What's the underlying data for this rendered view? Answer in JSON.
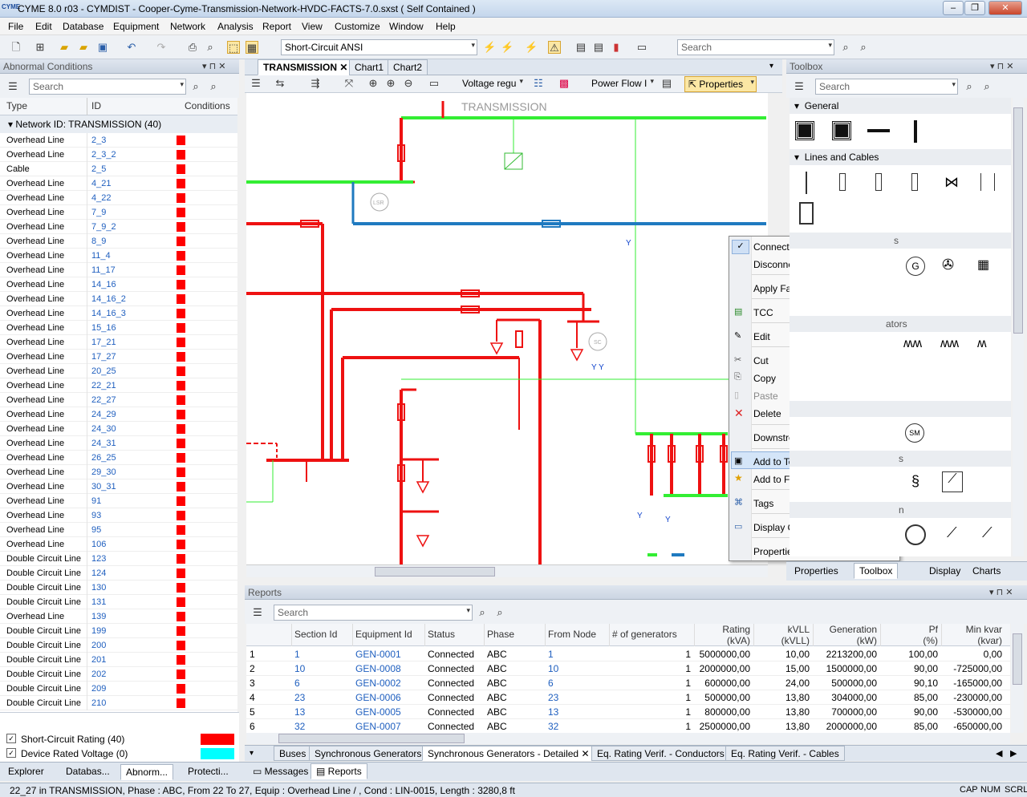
{
  "app": {
    "title": "CYME 8.0 r03 - CYMDIST - Cooper-Cyme-Transmission-Network-HVDC-FACTS-7.0.sxst ( Self Contained )",
    "logo": "CYME",
    "min": "–",
    "restore": "❐",
    "close": "✕"
  },
  "menu": [
    "File",
    "Edit",
    "Database",
    "Equipment",
    "Network",
    "Analysis",
    "Report",
    "View",
    "Customize",
    "Window",
    "Help"
  ],
  "toolbar": {
    "analysis_combo": "Short-Circuit ANSI",
    "search_placeholder": "Search",
    "dd": "▾"
  },
  "left": {
    "title": "Abnormal Conditions",
    "ctrl": "▾ ⊓ ✕",
    "search_placeholder": "Search",
    "col_type": "Type",
    "col_id": "ID",
    "col_cond": "Conditions",
    "group": "Network ID: TRANSMISSION (40)",
    "rows": [
      [
        "Overhead Line",
        "2_3"
      ],
      [
        "Overhead Line",
        "2_3_2"
      ],
      [
        "Cable",
        "2_5"
      ],
      [
        "Overhead Line",
        "4_21"
      ],
      [
        "Overhead Line",
        "4_22"
      ],
      [
        "Overhead Line",
        "7_9"
      ],
      [
        "Overhead Line",
        "7_9_2"
      ],
      [
        "Overhead Line",
        "8_9"
      ],
      [
        "Overhead Line",
        "11_4"
      ],
      [
        "Overhead Line",
        "11_17"
      ],
      [
        "Overhead Line",
        "14_16"
      ],
      [
        "Overhead Line",
        "14_16_2"
      ],
      [
        "Overhead Line",
        "14_16_3"
      ],
      [
        "Overhead Line",
        "15_16"
      ],
      [
        "Overhead Line",
        "17_21"
      ],
      [
        "Overhead Line",
        "17_27"
      ],
      [
        "Overhead Line",
        "20_25"
      ],
      [
        "Overhead Line",
        "22_21"
      ],
      [
        "Overhead Line",
        "22_27"
      ],
      [
        "Overhead Line",
        "24_29"
      ],
      [
        "Overhead Line",
        "24_30"
      ],
      [
        "Overhead Line",
        "24_31"
      ],
      [
        "Overhead Line",
        "26_25"
      ],
      [
        "Overhead Line",
        "29_30"
      ],
      [
        "Overhead Line",
        "30_31"
      ],
      [
        "Overhead Line",
        "91"
      ],
      [
        "Overhead Line",
        "93"
      ],
      [
        "Overhead Line",
        "95"
      ],
      [
        "Overhead Line",
        "106"
      ],
      [
        "Double Circuit Line",
        "123"
      ],
      [
        "Double Circuit Line",
        "124"
      ],
      [
        "Double Circuit Line",
        "130"
      ],
      [
        "Double Circuit Line",
        "131"
      ],
      [
        "Overhead Line",
        "139"
      ],
      [
        "Double Circuit Line",
        "199"
      ],
      [
        "Double Circuit Line",
        "200"
      ],
      [
        "Double Circuit Line",
        "201"
      ],
      [
        "Double Circuit Line",
        "202"
      ],
      [
        "Double Circuit Line",
        "209"
      ],
      [
        "Double Circuit Line",
        "210"
      ]
    ],
    "legend": [
      {
        "label": "Short-Circuit Rating (40)",
        "color": "#ff0000"
      },
      {
        "label": "Device Rated Voltage (0)",
        "color": "#00ffff"
      }
    ],
    "tabs": [
      "Explorer",
      "Databas...",
      "Abnorm...",
      "Protecti..."
    ]
  },
  "doc": {
    "tabs": [
      "TRANSMISSION",
      "Chart1",
      "Chart2"
    ],
    "voltage_combo": "Voltage regu",
    "flow_combo": "Power Flow I",
    "properties": "Properties",
    "diagram_title": "TRANSMISSION",
    "lbl_lsr": "LSR",
    "lbl_sc": "SC",
    "lbl_sm": "SM"
  },
  "context": {
    "items": [
      "Connected",
      "Disconnected",
      "Apply Fault",
      "TCC",
      "Edit",
      "Cut",
      "Copy",
      "Paste",
      "Delete",
      "Downstream Customer Load...",
      "Add to Toolbox...",
      "Add to Favorites",
      "Tags",
      "Display Options",
      "Properties..."
    ]
  },
  "toolbox": {
    "title": "Toolbox",
    "search_placeholder": "Search",
    "sections": [
      "General",
      "Lines and Cables"
    ],
    "partial": [
      "s",
      "ators",
      "s",
      "n"
    ],
    "tabs": [
      "Properties",
      "Toolbox",
      "Display",
      "Charts"
    ]
  },
  "reports": {
    "title": "Reports",
    "search_placeholder": "Search",
    "cols": [
      "Section Id",
      "Equipment Id",
      "Status",
      "Phase",
      "From Node",
      "# of generators",
      "Rating\n(kVA)",
      "kVLL\n(kVLL)",
      "Generation\n(kW)",
      "Pf\n(%)",
      "Min kvar\n(kvar)"
    ],
    "rows": [
      [
        "1",
        "1",
        "GEN-0001",
        "Connected",
        "ABC",
        "1",
        "1",
        "5000000,00",
        "10,00",
        "2213200,00",
        "100,00",
        "0,00"
      ],
      [
        "2",
        "10",
        "GEN-0008",
        "Connected",
        "ABC",
        "10",
        "1",
        "2000000,00",
        "15,00",
        "1500000,00",
        "90,00",
        "-725000,00"
      ],
      [
        "3",
        "6",
        "GEN-0002",
        "Connected",
        "ABC",
        "6",
        "1",
        "600000,00",
        "24,00",
        "500000,00",
        "90,10",
        "-165000,00"
      ],
      [
        "4",
        "23",
        "GEN-0006",
        "Connected",
        "ABC",
        "23",
        "1",
        "500000,00",
        "13,80",
        "304000,00",
        "85,00",
        "-230000,00"
      ],
      [
        "5",
        "13",
        "GEN-0005",
        "Connected",
        "ABC",
        "13",
        "1",
        "800000,00",
        "13,80",
        "700000,00",
        "90,00",
        "-530000,00"
      ],
      [
        "6",
        "32",
        "GEN-0007",
        "Connected",
        "ABC",
        "32",
        "1",
        "2500000,00",
        "13,80",
        "2000000,00",
        "85,00",
        "-650000,00"
      ]
    ],
    "bottom_tabs": [
      "Buses",
      "Synchronous Generators",
      "Synchronous Generators - Detailed",
      "Eq. Rating Verif. - Conductors",
      "Eq. Rating Verif. - Cables"
    ]
  },
  "bottom_tabs": [
    "Messages",
    "Reports"
  ],
  "status": {
    "text": "22_27 in TRANSMISSION, Phase : ABC, From 22 To 27, Equip : Overhead Line / , Cond : LIN-0015, Length : 3280,8 ft",
    "cap": "CAP",
    "num": "NUM",
    "scrl": "SCRL"
  }
}
